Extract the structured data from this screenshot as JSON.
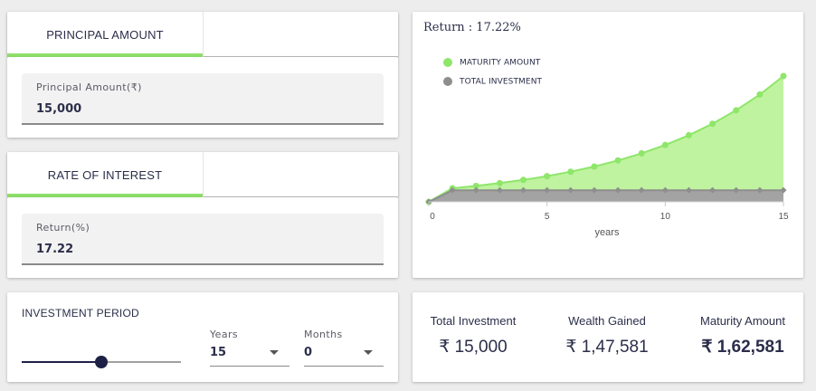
{
  "principal": {
    "tab_label": "PRINCIPAL AMOUNT",
    "field_label": "Principal Amount(₹)",
    "field_value": "15,000"
  },
  "interest": {
    "tab_label": "RATE OF INTEREST",
    "field_label": "Return(%)",
    "field_value": "17.22"
  },
  "period": {
    "title": "INVESTMENT PERIOD",
    "slider_fraction": 0.5,
    "years_label": "Years",
    "years_value": "15",
    "months_label": "Months",
    "months_value": "0"
  },
  "chart_title": "Return : 17.22%",
  "chart_data": {
    "type": "area",
    "title": "Return : 17.22%",
    "xlabel": "years",
    "ylabel": "",
    "x": [
      0,
      1,
      2,
      3,
      4,
      5,
      6,
      7,
      8,
      9,
      10,
      11,
      12,
      13,
      14,
      15
    ],
    "xticks": [
      "0",
      "5",
      "10",
      "15"
    ],
    "series": [
      {
        "name": "MATURITY AMOUNT",
        "color": "#8ee66a",
        "fill": "#bff39f",
        "values": [
          0,
          17583,
          20611,
          24161,
          28321,
          33198,
          38915,
          45616,
          53471,
          62679,
          73472,
          86124,
          100955,
          118339,
          138717,
          162581
        ]
      },
      {
        "name": "TOTAL INVESTMENT",
        "color": "#8e8e8e",
        "fill": "#a3a3a3",
        "values": [
          0,
          15000,
          15000,
          15000,
          15000,
          15000,
          15000,
          15000,
          15000,
          15000,
          15000,
          15000,
          15000,
          15000,
          15000,
          15000
        ]
      }
    ],
    "xlim": [
      0,
      15
    ],
    "ylim": [
      0,
      162581
    ],
    "legend": "top-left",
    "grid": false
  },
  "summary": {
    "total_investment_label": "Total Investment",
    "total_investment_value": "₹ 15,000",
    "wealth_gained_label": "Wealth Gained",
    "wealth_gained_value": "₹ 1,47,581",
    "maturity_amount_label": "Maturity Amount",
    "maturity_amount_value": "₹ 1,62,581"
  }
}
